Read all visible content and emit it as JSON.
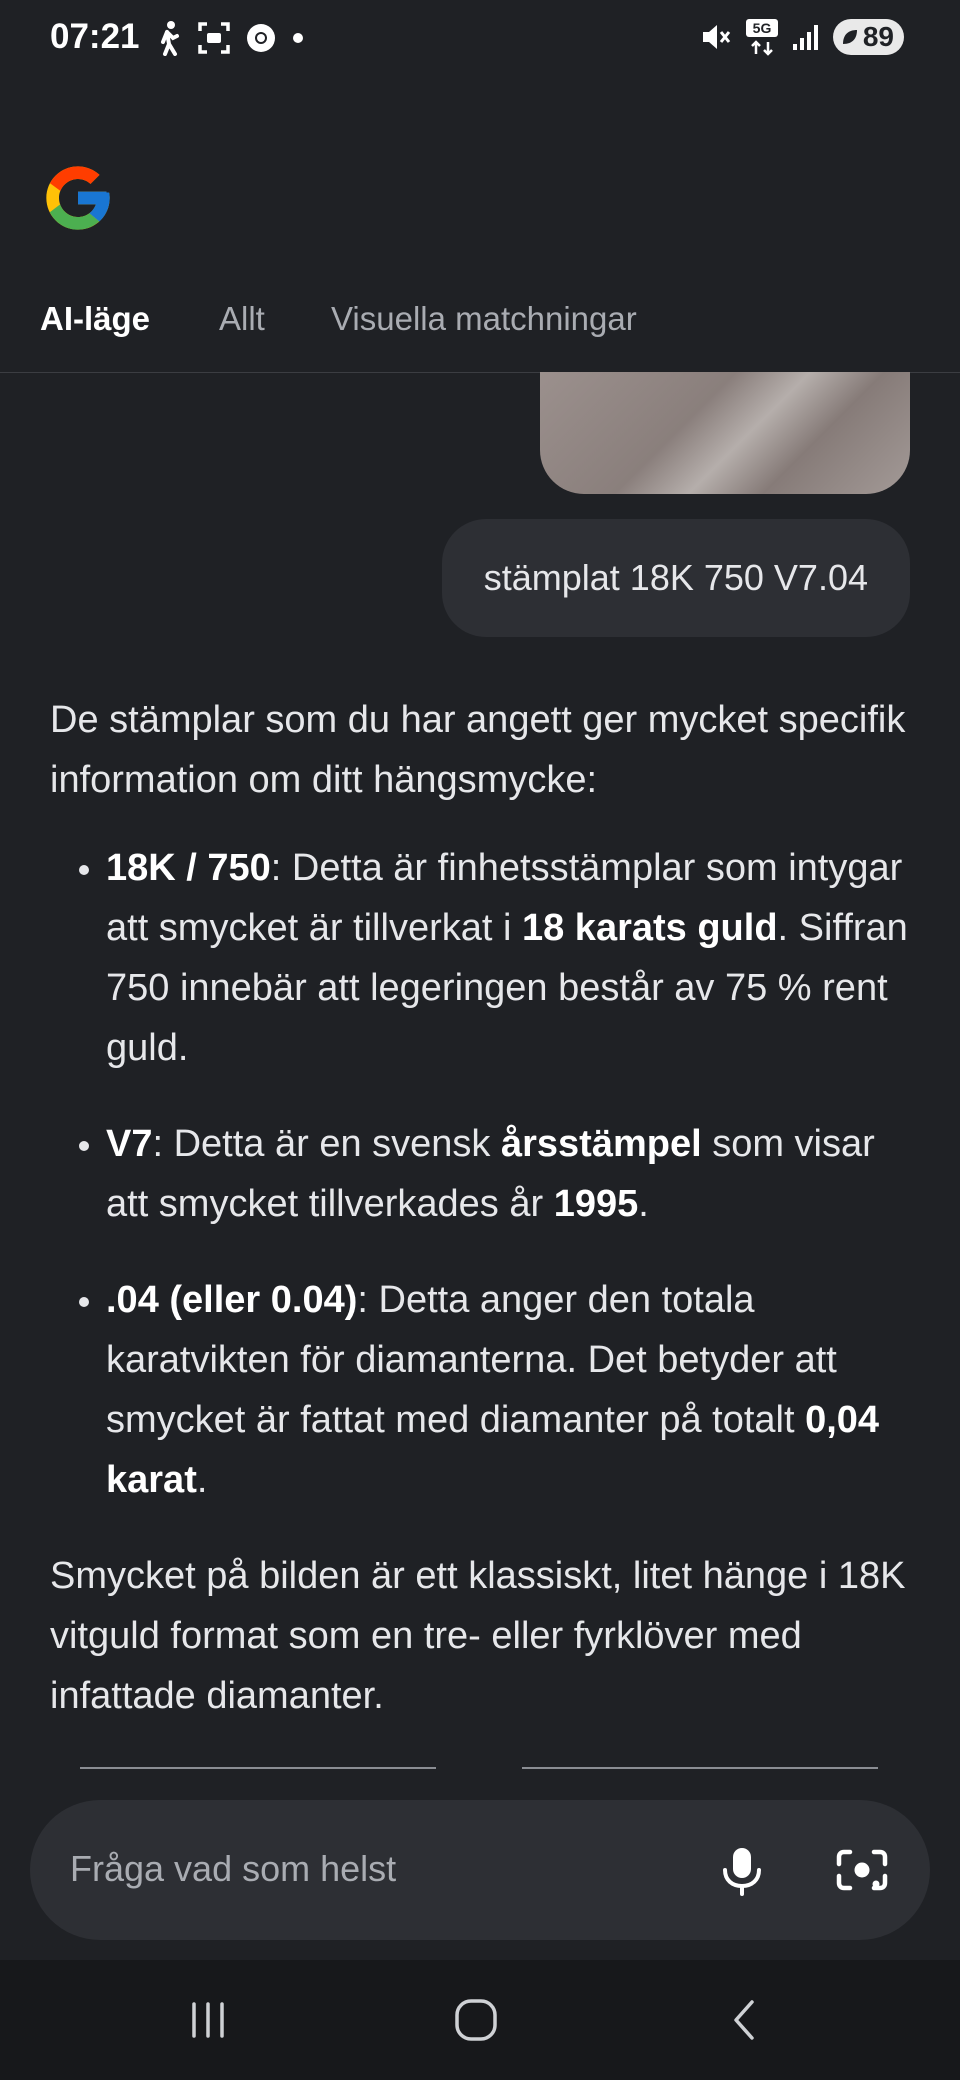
{
  "status_bar": {
    "time": "07:21",
    "left_icons": [
      "walking-icon",
      "screen-capture-icon",
      "chrome-icon",
      "dot-icon"
    ],
    "right_icons": [
      "mute-icon",
      "5g-icon",
      "signal-icon"
    ],
    "battery": "89"
  },
  "tabs": [
    {
      "label": "AI-läge",
      "active": true
    },
    {
      "label": "Allt",
      "active": false
    },
    {
      "label": "Visuella matchningar",
      "active": false
    }
  ],
  "user_message": "stämplat 18K 750 V7.04",
  "answer": {
    "intro": "De stämplar som du har angett ger mycket specifik information om ditt hängsmycke:",
    "bullets": [
      {
        "term": "18K / 750",
        "text_a": ": Detta är finhetsstämplar som intygar att smycket är tillverkat i ",
        "bold_a": "18 karats guld",
        "text_b": ". Siffran 750 innebär att legeringen består av 75 % rent guld."
      },
      {
        "term": "V7",
        "text_a": ": Detta är en svensk ",
        "bold_a": "årsstämpel",
        "text_b": " som visar att smycket tillverkades år ",
        "bold_b": "1995",
        "text_c": "."
      },
      {
        "term": ".04 (eller 0.04)",
        "text_a": ": Detta anger den totala karatvikten för diamanterna. Det betyder att smycket är fattat med diamanter på totalt ",
        "bold_a": "0,04 karat",
        "text_b": "."
      }
    ],
    "closing": "Smycket på bilden är ett klassiskt, litet hänge i 18K vitguld format som en tre- eller fyrklöver med infattade diamanter."
  },
  "search": {
    "placeholder": "Fråga vad som helst",
    "mic_icon": "microphone-icon",
    "lens_icon": "google-lens-icon"
  },
  "nav": [
    "recent-apps-icon",
    "home-icon",
    "back-icon"
  ]
}
